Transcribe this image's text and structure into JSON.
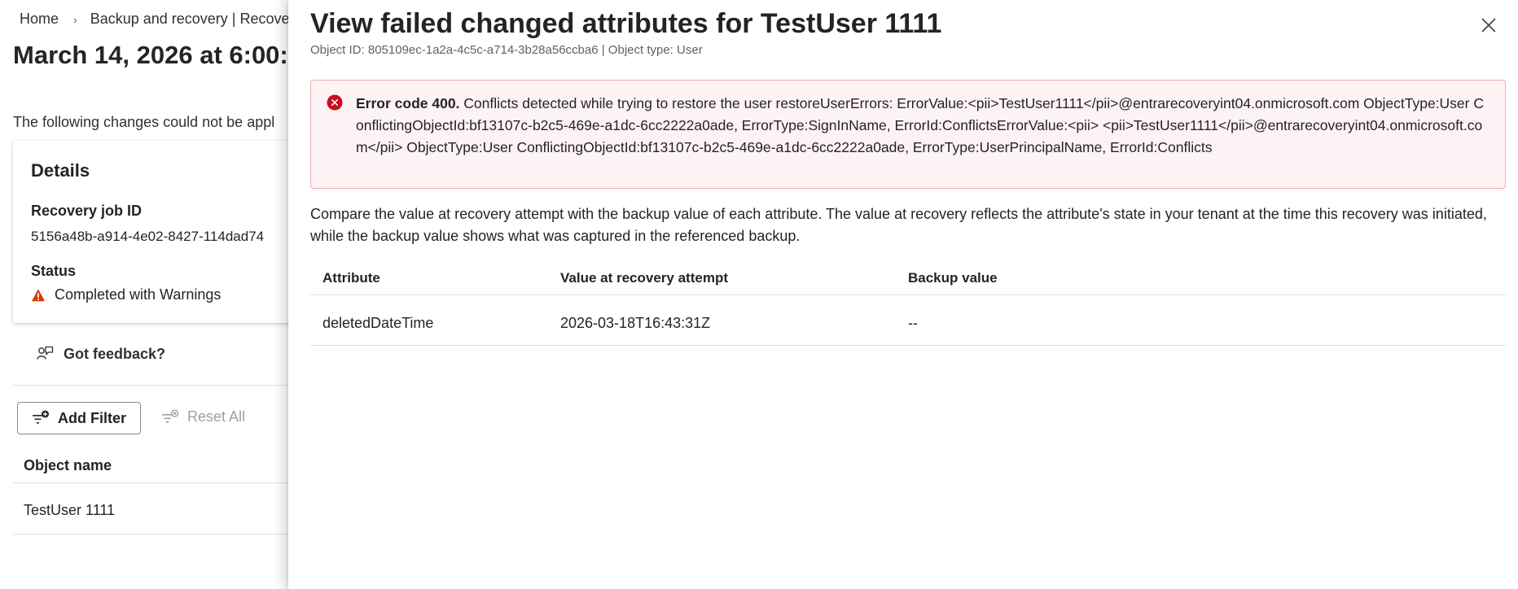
{
  "breadcrumb": {
    "items": [
      "Home",
      "Backup and recovery | Recove"
    ]
  },
  "page": {
    "title": "March 14, 2026 at 6:00:",
    "subtext": "The following changes could not be appl"
  },
  "details": {
    "title": "Details",
    "recovery_job_id_label": "Recovery job ID",
    "recovery_job_id_value": "5156a48b-a914-4e02-8427-114dad74",
    "status_label": "Status",
    "status_value": "Completed with Warnings"
  },
  "feedback": {
    "label": "Got feedback?"
  },
  "toolbar": {
    "add_filter_label": "Add Filter",
    "reset_all_label": "Reset All"
  },
  "list": {
    "column_header": "Object name",
    "rows": [
      "TestUser 1111"
    ]
  },
  "panel": {
    "title": "View failed changed attributes for TestUser 1111",
    "subtitle": "Object ID: 805109ec-1a2a-4c5c-a714-3b28a56ccba6 | Object type: User",
    "error": {
      "code": "Error code 400.",
      "message": "Conflicts detected while trying to restore the user restoreUserErrors: ErrorValue:<pii>TestUser1111</pii>@entrarecoveryint04.onmicrosoft.com ObjectType:User ConflictingObjectId:bf13107c-b2c5-469e-a1dc-6cc2222a0ade, ErrorType:SignInName, ErrorId:ConflictsErrorValue:<pii> <pii>TestUser1111</pii>@entrarecoveryint04.onmicrosoft.com</pii> ObjectType:User ConflictingObjectId:bf13107c-b2c5-469e-a1dc-6cc2222a0ade, ErrorType:UserPrincipalName, ErrorId:Conflicts"
    },
    "description": "Compare the value at recovery attempt with the backup value of each attribute. The value at recovery reflects the attribute's state in your tenant at the time this recovery was initiated, while the backup value shows what was captured in the referenced backup.",
    "table": {
      "headers": [
        "Attribute",
        "Value at recovery attempt",
        "Backup value"
      ],
      "rows": [
        [
          "deletedDateTime",
          "2026-03-18T16:43:31Z",
          "--"
        ]
      ]
    }
  },
  "icons": {
    "breadcrumb_separator": "chevron-right-icon",
    "status": "warning-icon",
    "feedback": "feedback-icon",
    "add_filter": "add-filter-icon",
    "reset_all": "reset-filter-icon",
    "error": "error-circle-icon",
    "close": "close-icon"
  },
  "colors": {
    "warning": "#d83b01",
    "error_icon": "#c50f1f",
    "error_background": "#fdf3f4",
    "error_border": "#eeacb2",
    "disabled_text": "#a19f9d"
  }
}
